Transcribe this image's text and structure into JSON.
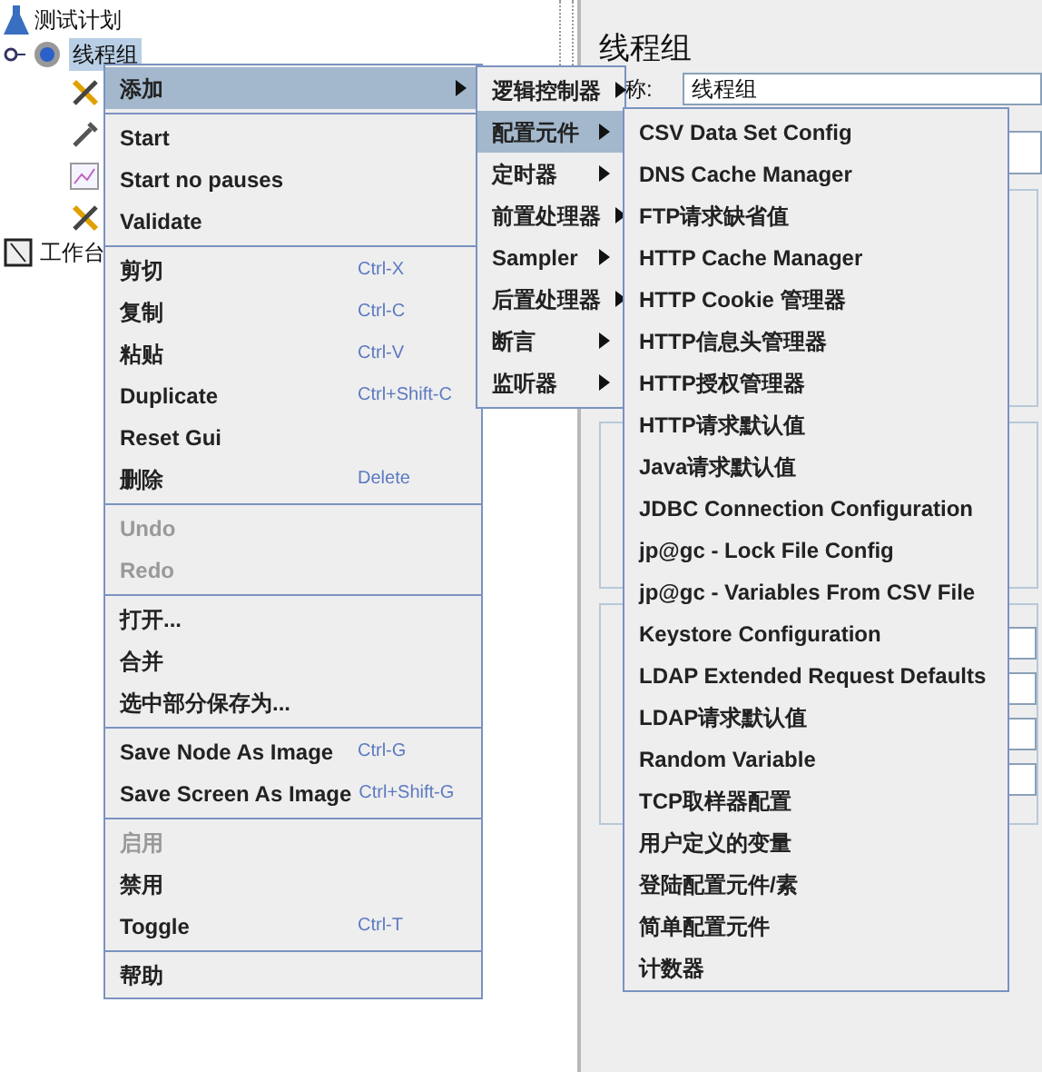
{
  "tree": {
    "root": {
      "label": "测试计划",
      "expanded": true,
      "children": [
        {
          "label": "线程组",
          "selected": true
        }
      ]
    },
    "workbench": {
      "label": "工作台"
    }
  },
  "panel": {
    "title": "线程组",
    "name_label": "称:",
    "name_value": "线程组"
  },
  "context_menu": {
    "items": [
      {
        "kind": "item",
        "label": "添加",
        "submenu": true,
        "selected": true,
        "disabled": false
      },
      {
        "kind": "separator"
      },
      {
        "kind": "item",
        "label": "Start",
        "selected": false,
        "disabled": false
      },
      {
        "kind": "item",
        "label": "Start no pauses",
        "selected": false,
        "disabled": false
      },
      {
        "kind": "item",
        "label": "Validate",
        "selected": false,
        "disabled": false
      },
      {
        "kind": "separator"
      },
      {
        "kind": "item",
        "label": "剪切",
        "shortcut": "Ctrl-X",
        "selected": false,
        "disabled": false
      },
      {
        "kind": "item",
        "label": "复制",
        "shortcut": "Ctrl-C",
        "selected": false,
        "disabled": false
      },
      {
        "kind": "item",
        "label": "粘贴",
        "shortcut": "Ctrl-V",
        "selected": false,
        "disabled": false
      },
      {
        "kind": "item",
        "label": "Duplicate",
        "shortcut": "Ctrl+Shift-C",
        "selected": false,
        "disabled": false
      },
      {
        "kind": "item",
        "label": "Reset Gui",
        "selected": false,
        "disabled": false
      },
      {
        "kind": "item",
        "label": "删除",
        "shortcut": "Delete",
        "selected": false,
        "disabled": false
      },
      {
        "kind": "separator"
      },
      {
        "kind": "item",
        "label": "Undo",
        "selected": false,
        "disabled": true
      },
      {
        "kind": "item",
        "label": "Redo",
        "selected": false,
        "disabled": true
      },
      {
        "kind": "separator"
      },
      {
        "kind": "item",
        "label": "打开...",
        "selected": false,
        "disabled": false
      },
      {
        "kind": "item",
        "label": "合并",
        "selected": false,
        "disabled": false
      },
      {
        "kind": "item",
        "label": "选中部分保存为...",
        "selected": false,
        "disabled": false
      },
      {
        "kind": "separator"
      },
      {
        "kind": "item",
        "label": "Save Node As Image",
        "shortcut": "Ctrl-G",
        "selected": false,
        "disabled": false
      },
      {
        "kind": "item",
        "label": "Save Screen As Image",
        "shortcut": "Ctrl+Shift-G",
        "selected": false,
        "disabled": false
      },
      {
        "kind": "separator"
      },
      {
        "kind": "item",
        "label": "启用",
        "selected": false,
        "disabled": true
      },
      {
        "kind": "item",
        "label": "禁用",
        "selected": false,
        "disabled": false
      },
      {
        "kind": "item",
        "label": "Toggle",
        "shortcut": "Ctrl-T",
        "selected": false,
        "disabled": false
      },
      {
        "kind": "separator"
      },
      {
        "kind": "item",
        "label": "帮助",
        "selected": false,
        "disabled": false
      }
    ]
  },
  "add_submenu": {
    "items": [
      {
        "label": "逻辑控制器",
        "submenu": true,
        "selected": false
      },
      {
        "label": "配置元件",
        "submenu": true,
        "selected": true
      },
      {
        "label": "定时器",
        "submenu": true,
        "selected": false
      },
      {
        "label": "前置处理器",
        "submenu": true,
        "selected": false
      },
      {
        "label": "Sampler",
        "submenu": true,
        "selected": false
      },
      {
        "label": "后置处理器",
        "submenu": true,
        "selected": false
      },
      {
        "label": "断言",
        "submenu": true,
        "selected": false
      },
      {
        "label": "监听器",
        "submenu": true,
        "selected": false
      }
    ]
  },
  "config_submenu": {
    "items": [
      {
        "label": "CSV Data Set Config",
        "selected": false
      },
      {
        "label": "DNS Cache Manager",
        "selected": false
      },
      {
        "label": "FTP请求缺省值",
        "selected": false
      },
      {
        "label": "HTTP Cache Manager",
        "selected": false
      },
      {
        "label": "HTTP Cookie 管理器",
        "selected": false
      },
      {
        "label": "HTTP信息头管理器",
        "selected": false
      },
      {
        "label": "HTTP授权管理器",
        "selected": false
      },
      {
        "label": "HTTP请求默认值",
        "selected": false
      },
      {
        "label": "Java请求默认值",
        "selected": false
      },
      {
        "label": "JDBC Connection Configuration",
        "selected": false
      },
      {
        "label": "jp@gc - Lock File Config",
        "selected": false
      },
      {
        "label": "jp@gc - Variables From CSV File",
        "selected": false
      },
      {
        "label": "Keystore Configuration",
        "selected": false
      },
      {
        "label": "LDAP Extended Request Defaults",
        "selected": false
      },
      {
        "label": "LDAP请求默认值",
        "selected": false
      },
      {
        "label": "Random Variable",
        "selected": false
      },
      {
        "label": "TCP取样器配置",
        "selected": false
      },
      {
        "label": "用户定义的变量",
        "selected": false
      },
      {
        "label": "登陆配置元件/素",
        "selected": false
      },
      {
        "label": "简单配置元件",
        "selected": false
      },
      {
        "label": "计数器",
        "selected": false
      }
    ]
  }
}
